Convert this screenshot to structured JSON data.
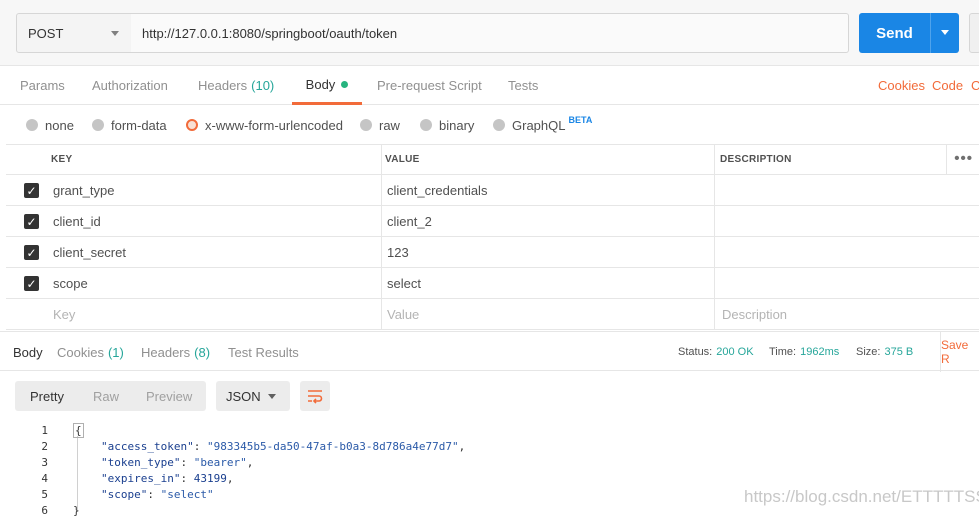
{
  "request": {
    "method": "POST",
    "url": "http://127.0.0.1:8080/springboot/oauth/token",
    "send_label": "Send"
  },
  "req_tabs": [
    {
      "label": "Params"
    },
    {
      "label": "Authorization"
    },
    {
      "label": "Headers",
      "count": "(10)"
    },
    {
      "label": "Body"
    },
    {
      "label": "Pre-request Script"
    },
    {
      "label": "Tests"
    }
  ],
  "right_links": {
    "cookies": "Cookies",
    "code": "Code"
  },
  "body_types": [
    {
      "label": "none"
    },
    {
      "label": "form-data"
    },
    {
      "label": "x-www-form-urlencoded"
    },
    {
      "label": "raw"
    },
    {
      "label": "binary"
    },
    {
      "label": "GraphQL",
      "badge": "BETA"
    }
  ],
  "table": {
    "headers": {
      "key": "KEY",
      "value": "VALUE",
      "description": "DESCRIPTION"
    },
    "rows": [
      {
        "key": "grant_type",
        "value": "client_credentials"
      },
      {
        "key": "client_id",
        "value": "client_2"
      },
      {
        "key": "client_secret",
        "value": "123"
      },
      {
        "key": "scope",
        "value": "select"
      }
    ],
    "placeholders": {
      "key": "Key",
      "value": "Value",
      "description": "Description"
    }
  },
  "resp_tabs": [
    {
      "label": "Body"
    },
    {
      "label": "Cookies",
      "count": "(1)"
    },
    {
      "label": "Headers",
      "count": "(8)"
    },
    {
      "label": "Test Results"
    }
  ],
  "status": {
    "status_label": "Status:",
    "status_value": "200 OK",
    "time_label": "Time:",
    "time_value": "1962ms",
    "size_label": "Size:",
    "size_value": "375 B",
    "save_label": "Save R"
  },
  "view_modes": [
    "Pretty",
    "Raw",
    "Preview"
  ],
  "format": "JSON",
  "code_lines": [
    {
      "n": "1",
      "text": "{"
    },
    {
      "n": "2",
      "key": "\"access_token\"",
      "val": "\"983345b5-da50-47af-b0a3-8d786a4e77d7\"",
      "tail": ","
    },
    {
      "n": "3",
      "key": "\"token_type\"",
      "val": "\"bearer\"",
      "tail": ","
    },
    {
      "n": "4",
      "key": "\"expires_in\"",
      "val": "43199",
      "tail": ","
    },
    {
      "n": "5",
      "key": "\"scope\"",
      "val": "\"select\"",
      "tail": ""
    },
    {
      "n": "6",
      "text": "}"
    }
  ],
  "watermark": "https://blog.csdn.net/ETTTTTSS",
  "colors": {
    "accent": "#f26b3a",
    "send": "#1a86e5",
    "ok": "#26a69a"
  }
}
